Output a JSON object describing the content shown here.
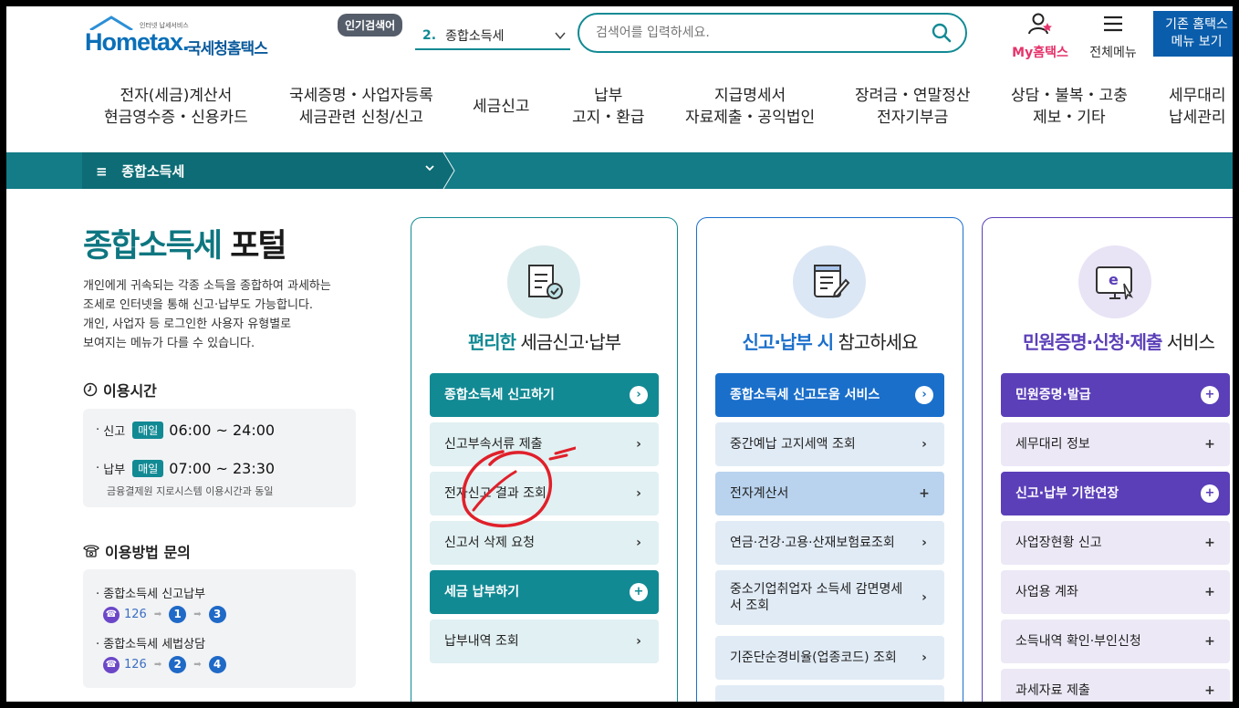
{
  "header": {
    "logo_tagline": "인터넷 납세서비스",
    "logo_brand": "Hometax.",
    "logo_korean": "국세청홈택스",
    "popular_badge": "인기검색어",
    "popular_num": "2.",
    "popular_term": "종합소득세",
    "search_placeholder": "검색어를 입력하세요.",
    "my_hometax": "My홈택스",
    "all_menu": "전체메뉴",
    "old_home_line1": "기존 홈택스",
    "old_home_line2": "메뉴 보기"
  },
  "gnb": [
    {
      "l1": "전자(세금)계산서",
      "l2": "현금영수증・신용카드"
    },
    {
      "l1": "국세증명・사업자등록",
      "l2": "세금관련 신청/신고"
    },
    {
      "l1": "세금신고",
      "l2": ""
    },
    {
      "l1": "납부",
      "l2": "고지・환급"
    },
    {
      "l1": "지급명세서",
      "l2": "자료제출・공익법인"
    },
    {
      "l1": "장려금・연말정산",
      "l2": "전자기부금"
    },
    {
      "l1": "상담・불복・고충",
      "l2": "제보・기타"
    },
    {
      "l1": "세무대리",
      "l2": "납세관리"
    }
  ],
  "bar": {
    "label": "종합소득세"
  },
  "left": {
    "title_hl": "종합소득세",
    "title_rest": " 포털",
    "desc": [
      "개인에게 귀속되는 각종 소득을 종합하여 과세하는",
      "조세로 인터넷을 통해 신고·납부도 가능합니다.",
      "개인, 사업자 등 로그인한 사용자 유형별로",
      "보여지는 메뉴가 다를 수 있습니다."
    ],
    "hours_title": "이용시간",
    "hours": [
      {
        "label": "신고",
        "badge": "매일",
        "time": "06:00 ~ 24:00"
      },
      {
        "label": "납부",
        "badge": "매일",
        "time": "07:00 ~ 23:30",
        "note": "금융결제원 지로시스템 이용시간과 동일"
      }
    ],
    "inquiry_title": "이용방법 문의",
    "inquiry": [
      {
        "label": "종합소득세 신고납부",
        "phone": "126",
        "n1": "1",
        "n2": "3"
      },
      {
        "label": "종합소득세 세법상담",
        "phone": "126",
        "n1": "2",
        "n2": "4"
      }
    ]
  },
  "cards": [
    {
      "title_hl": "편리한",
      "title_rest": " 세금신고·납부",
      "accent": "#128a94",
      "items": [
        {
          "label": "종합소득세 신고하기",
          "type": "hd",
          "icon": "chevron-right-icon"
        },
        {
          "label": "신고부속서류 제출",
          "type": "sub",
          "icon": "chevron-right-icon"
        },
        {
          "label": "전자신고 결과 조회",
          "type": "sub",
          "icon": "chevron-right-icon"
        },
        {
          "label": "신고서 삭제 요청",
          "type": "sub",
          "icon": "chevron-right-icon"
        },
        {
          "label": "세금 납부하기",
          "type": "hd",
          "icon": "plus-icon"
        },
        {
          "label": "납부내역 조회",
          "type": "sub",
          "icon": "chevron-right-icon"
        }
      ]
    },
    {
      "title_hl": "신고·납부 시",
      "title_rest": " 참고하세요",
      "accent": "#1a6fcb",
      "items": [
        {
          "label": "종합소득세 신고도움 서비스",
          "type": "hd",
          "icon": "chevron-right-icon"
        },
        {
          "label": "중간예납 고지세액 조회",
          "type": "sub",
          "icon": "chevron-right-icon"
        },
        {
          "label": "전자계산서",
          "type": "sub2",
          "icon": "plus-icon"
        },
        {
          "label": "연금·건강·고용·산재보험료조회",
          "type": "sub",
          "icon": "chevron-right-icon"
        },
        {
          "label": "중소기업취업자 소득세 감면명세서 조회",
          "type": "sub",
          "icon": "chevron-right-icon"
        },
        {
          "label": "기준단순경비율(업종코드) 조회",
          "type": "sub",
          "icon": "chevron-right-icon"
        }
      ]
    },
    {
      "title_hl": "민원증명·신청·제출",
      "title_rest": " 서비스",
      "accent": "#5b3fb8",
      "items": [
        {
          "label": "민원증명·발급",
          "type": "hd",
          "icon": "plus-icon"
        },
        {
          "label": "세무대리 정보",
          "type": "sub",
          "icon": "plus-icon"
        },
        {
          "label": "신고·납부 기한연장",
          "type": "hd",
          "icon": "plus-icon"
        },
        {
          "label": "사업장현황 신고",
          "type": "sub",
          "icon": "plus-icon"
        },
        {
          "label": "사업용 계좌",
          "type": "sub",
          "icon": "plus-icon"
        },
        {
          "label": "소득내역 확인·부인신청",
          "type": "sub",
          "icon": "plus-icon"
        },
        {
          "label": "과세자료 제출",
          "type": "sub",
          "icon": "plus-icon"
        }
      ]
    }
  ]
}
